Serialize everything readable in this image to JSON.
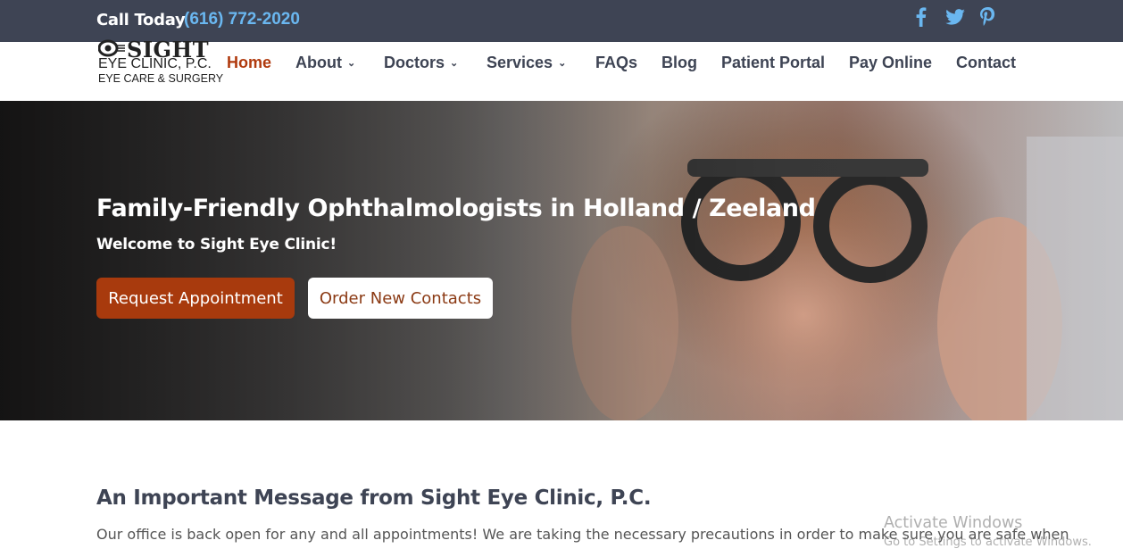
{
  "topbar": {
    "call_label": "Call Today",
    "phone": "(616) 772-2020",
    "social": [
      {
        "name": "facebook-icon"
      },
      {
        "name": "twitter-icon"
      },
      {
        "name": "pinterest-icon"
      }
    ]
  },
  "logo": {
    "line1": "SIGHT",
    "line2": "EYE CLINIC,  P.C.",
    "line3": "EYE CARE & SURGERY"
  },
  "nav": {
    "items": [
      {
        "label": "Home",
        "active": true,
        "dropdown": false
      },
      {
        "label": "About",
        "dropdown": true
      },
      {
        "label": "Doctors",
        "dropdown": true
      },
      {
        "label": "Services",
        "dropdown": true
      },
      {
        "label": "FAQs",
        "dropdown": false
      },
      {
        "label": "Blog",
        "dropdown": false
      },
      {
        "label": "Patient Portal",
        "dropdown": false
      },
      {
        "label": "Pay Online",
        "dropdown": false
      },
      {
        "label": "Contact",
        "dropdown": false
      }
    ]
  },
  "hero": {
    "title": "Family-Friendly Ophthalmologists in Holland / Zeeland",
    "subtitle": "Welcome to Sight Eye Clinic!",
    "primary_button": "Request Appointment",
    "secondary_button": "Order New Contacts"
  },
  "message": {
    "title": "An Important Message from Sight Eye Clinic, P.C.",
    "body": "Our office is back open for any and all appointments! We are taking the necessary precautions in order to make sure you are safe when"
  },
  "watermark": {
    "line1": "Activate Windows",
    "line2": "Go to Settings to activate Windows."
  },
  "colors": {
    "topbar": "#3e4454",
    "phone": "#6ab7f0",
    "accent": "#a83a0d",
    "nav_text": "#3e4454",
    "social": "#6ab7f0"
  }
}
